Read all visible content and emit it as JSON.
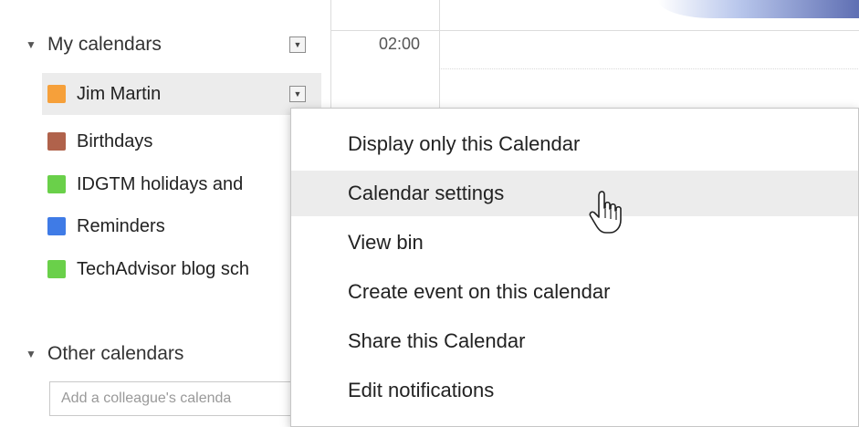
{
  "sidebar": {
    "my_calendars": {
      "title": "My calendars",
      "items": [
        {
          "label": "Jim Martin",
          "color": "#f6a03a",
          "selected": true
        },
        {
          "label": "Birthdays",
          "color": "#b0624b"
        },
        {
          "label": "IDGTM holidays and",
          "color": "#6ad04a"
        },
        {
          "label": "Reminders",
          "color": "#3f7be6"
        },
        {
          "label": "TechAdvisor blog sch",
          "color": "#6ad04a"
        }
      ]
    },
    "other_calendars": {
      "title": "Other calendars",
      "add_placeholder": "Add a colleague's calenda"
    }
  },
  "grid": {
    "time_label": "02:00"
  },
  "dropdown": {
    "items": [
      {
        "label": "Display only this Calendar"
      },
      {
        "label": "Calendar settings",
        "hover": true
      },
      {
        "label": "View bin"
      },
      {
        "label": "Create event on this calendar"
      },
      {
        "label": "Share this Calendar"
      },
      {
        "label": "Edit notifications"
      }
    ]
  },
  "icons": {
    "section_toggle": "triangle-down",
    "menu_button": "chevron-down",
    "pointer": "hand-pointer"
  }
}
